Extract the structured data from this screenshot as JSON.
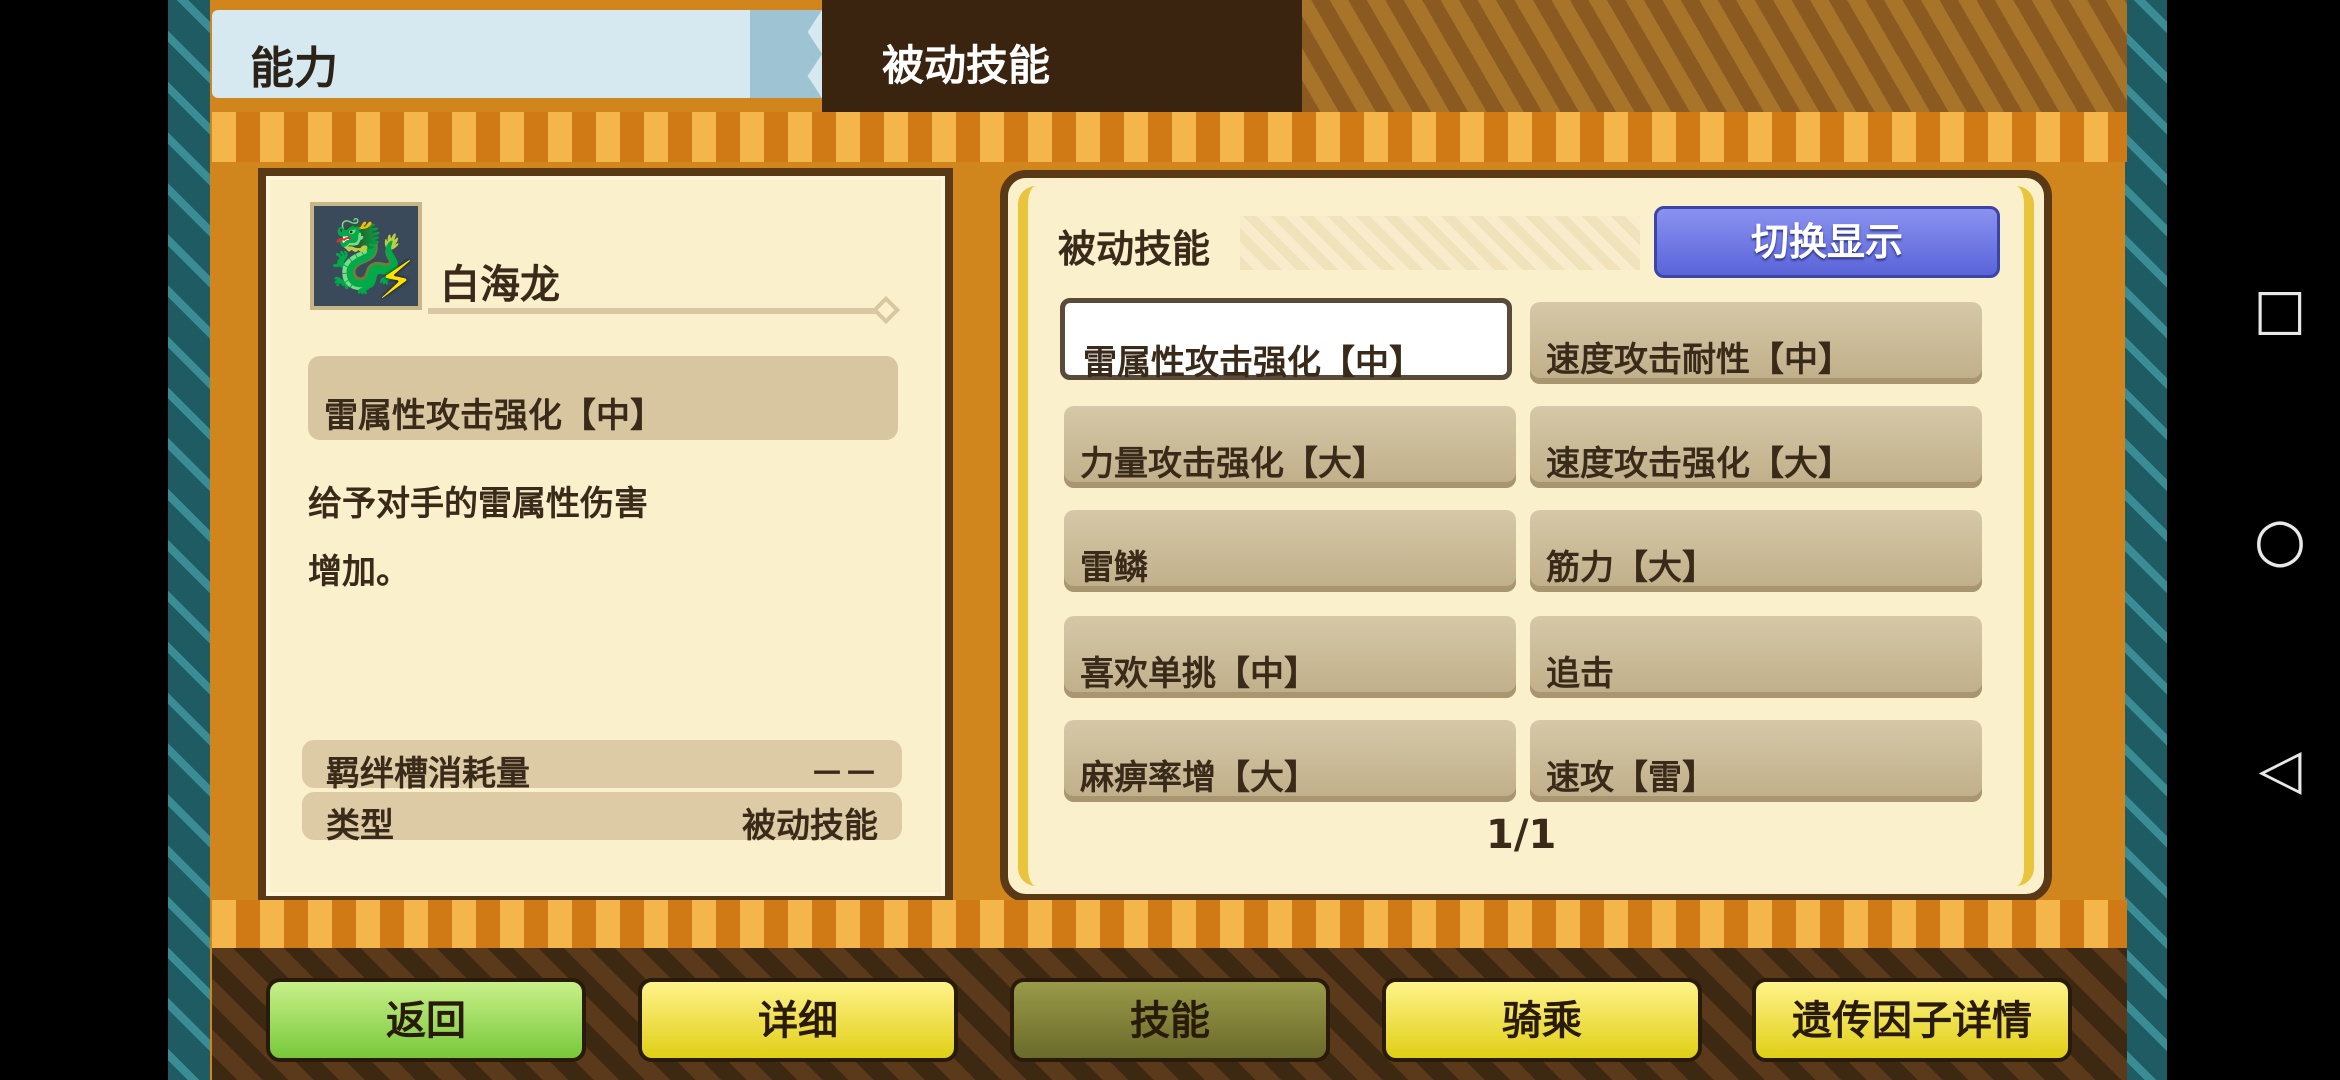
{
  "header": {
    "tab_label": "能力",
    "section_title": "被动技能"
  },
  "monster": {
    "icon": "ice-dragon-icon",
    "element_icon": "lightning-bolt-icon",
    "name": "白海龙"
  },
  "selected_skill": {
    "name": "雷属性攻击强化【中】",
    "description_line1": "给予对手的雷属性伤害",
    "description_line2": "增加。",
    "bond_label": "羁绊槽消耗量",
    "bond_value": "－－",
    "type_label": "类型",
    "type_value": "被动技能"
  },
  "passive_panel": {
    "title": "被动技能",
    "switch_label": "切换显示",
    "skills": [
      {
        "label": "雷属性攻击强化【中】",
        "selected": true
      },
      {
        "label": "速度攻击耐性【中】",
        "selected": false
      },
      {
        "label": "力量攻击强化【大】",
        "selected": false
      },
      {
        "label": "速度攻击强化【大】",
        "selected": false
      },
      {
        "label": "雷鳞",
        "selected": false
      },
      {
        "label": "筋力【大】",
        "selected": false
      },
      {
        "label": "喜欢单挑【中】",
        "selected": false
      },
      {
        "label": "追击",
        "selected": false
      },
      {
        "label": "麻痹率增【大】",
        "selected": false
      },
      {
        "label": "速攻【雷】",
        "selected": false
      }
    ],
    "page": "1/1"
  },
  "bottom_nav": {
    "back": "返回",
    "detail": "详细",
    "skills": "技能",
    "ride": "骑乘",
    "gene": "遗传因子详情"
  },
  "system_nav": {
    "recent": "□",
    "home": "○",
    "back": "◁"
  },
  "colors": {
    "frame_orange": "#d0861c",
    "parchment": "#fbf0cc",
    "switch_blue": "#6a72e0",
    "nav_green": "#8ed84a",
    "nav_yellow": "#efe030"
  }
}
